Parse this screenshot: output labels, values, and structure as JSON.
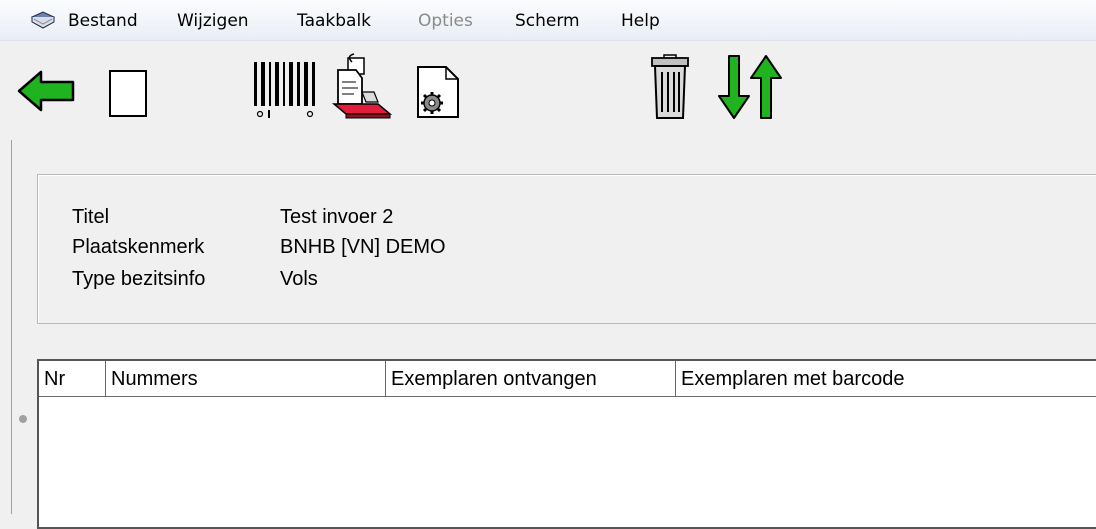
{
  "menubar": {
    "items": [
      {
        "label": "Bestand",
        "enabled": true
      },
      {
        "label": "Wijzigen",
        "enabled": true
      },
      {
        "label": "Taakbalk",
        "enabled": true
      },
      {
        "label": "Opties",
        "enabled": false
      },
      {
        "label": "Scherm",
        "enabled": true
      },
      {
        "label": "Help",
        "enabled": true
      }
    ]
  },
  "toolbar": {
    "buttons": [
      "back-arrow-icon",
      "blank-page-icon",
      "barcode-icon",
      "print-icon",
      "page-settings-icon",
      "trash-icon",
      "sort-arrows-icon"
    ]
  },
  "info": {
    "rows": [
      {
        "label": "Titel",
        "value": "Test invoer 2"
      },
      {
        "label": "Plaatskenmerk",
        "value": "BNHB [VN] DEMO"
      },
      {
        "label": "Type bezitsinfo",
        "value": "Vols"
      }
    ]
  },
  "grid": {
    "columns": [
      "Nr",
      "Nummers",
      "Exemplaren ontvangen",
      "Exemplaren met barcode"
    ]
  },
  "colors": {
    "accent_green": "#1fb31f",
    "menubar_bg": "#eef2f8"
  }
}
